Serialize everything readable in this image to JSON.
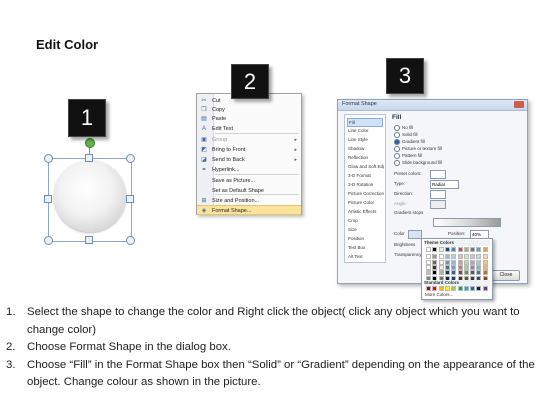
{
  "page_title": "Edit Color",
  "badges": [
    "1",
    "2",
    "3"
  ],
  "context_menu": {
    "items": [
      {
        "icon": "cut-icon",
        "glyph": "✂",
        "label": "Cut",
        "arrow": "",
        "disabled": false
      },
      {
        "icon": "copy-icon",
        "glyph": "❐",
        "label": "Copy",
        "arrow": "",
        "disabled": false
      },
      {
        "icon": "paste-icon",
        "glyph": "▤",
        "label": "Paste",
        "arrow": "",
        "disabled": false
      },
      {
        "icon": "edit-text-icon",
        "glyph": "A",
        "label": "Edit Text",
        "arrow": "",
        "disabled": false
      },
      {
        "icon": "group-icon",
        "glyph": "▣",
        "label": "Group",
        "arrow": "▸",
        "disabled": true
      },
      {
        "icon": "bring-to-front-icon",
        "glyph": "◩",
        "label": "Bring to Front",
        "arrow": "▸",
        "disabled": false
      },
      {
        "icon": "send-to-back-icon",
        "glyph": "◪",
        "label": "Send to Back",
        "arrow": "▸",
        "disabled": false
      },
      {
        "icon": "hyperlink-icon",
        "glyph": "⚭",
        "label": "Hyperlink...",
        "arrow": "",
        "disabled": false
      },
      {
        "icon": "",
        "glyph": "",
        "label": "Save as Picture...",
        "arrow": "",
        "disabled": false
      },
      {
        "icon": "",
        "glyph": "",
        "label": "Set as Default Shape",
        "arrow": "",
        "disabled": false
      },
      {
        "icon": "size-position-icon",
        "glyph": "⊞",
        "label": "Size and Position...",
        "arrow": "",
        "disabled": false
      },
      {
        "icon": "format-shape-icon",
        "glyph": "◈",
        "label": "Format Shape...",
        "arrow": "",
        "disabled": false
      }
    ]
  },
  "dialog": {
    "title": "Format Shape",
    "sidebar": [
      "Fill",
      "Line Color",
      "Line Style",
      "Shadow",
      "Reflection",
      "Glow and Soft Edges",
      "3-D Format",
      "3-D Rotation",
      "Picture Corrections",
      "Picture Color",
      "Artistic Effects",
      "Crop",
      "Size",
      "Position",
      "Text Box",
      "Alt Text"
    ],
    "section": "Fill",
    "fill_options": [
      "No fill",
      "Solid fill",
      "Gradient fill",
      "Picture or texture fill",
      "Pattern fill",
      "Slide background fill"
    ],
    "preset_label": "Preset colors:",
    "type_label": "Type:",
    "type_value": "Radial",
    "direction_label": "Direction:",
    "angle_label": "Angle:",
    "stops_label": "Gradient stops",
    "color_label": "Color",
    "position_label": "Position:",
    "position_value": "40%",
    "brightness_label": "Brightness",
    "transparency_label": "Transparency",
    "rotate_label": "Rotate with shape",
    "theme_colors": "Theme Colors",
    "standard_colors": "Standard Colors",
    "more_colors": "More Colors...",
    "close_label": "Close",
    "theme_palette": [
      "#ffffff",
      "#000000",
      "#eeece1",
      "#1f497d",
      "#4f81bd",
      "#c0504d",
      "#9bbb59",
      "#8064a2",
      "#4bacc6",
      "#f79646"
    ],
    "standard_palette": [
      "#c00000",
      "#ff0000",
      "#ffc000",
      "#ffff00",
      "#92d050",
      "#00b050",
      "#00b0f0",
      "#0070c0",
      "#002060",
      "#7030a0"
    ]
  },
  "steps": [
    {
      "num": "1.",
      "text": "Select the shape to change the color and Right click the object( click any object which you want to change color)"
    },
    {
      "num": "2.",
      "text": "Choose Format Shape in the dialog box."
    },
    {
      "num": "3.",
      "text": "Choose “Fill” in the Format Shape box then “Solid” or “Gradient” depending on the appearance of the object. Change colour as shown in the picture."
    }
  ]
}
